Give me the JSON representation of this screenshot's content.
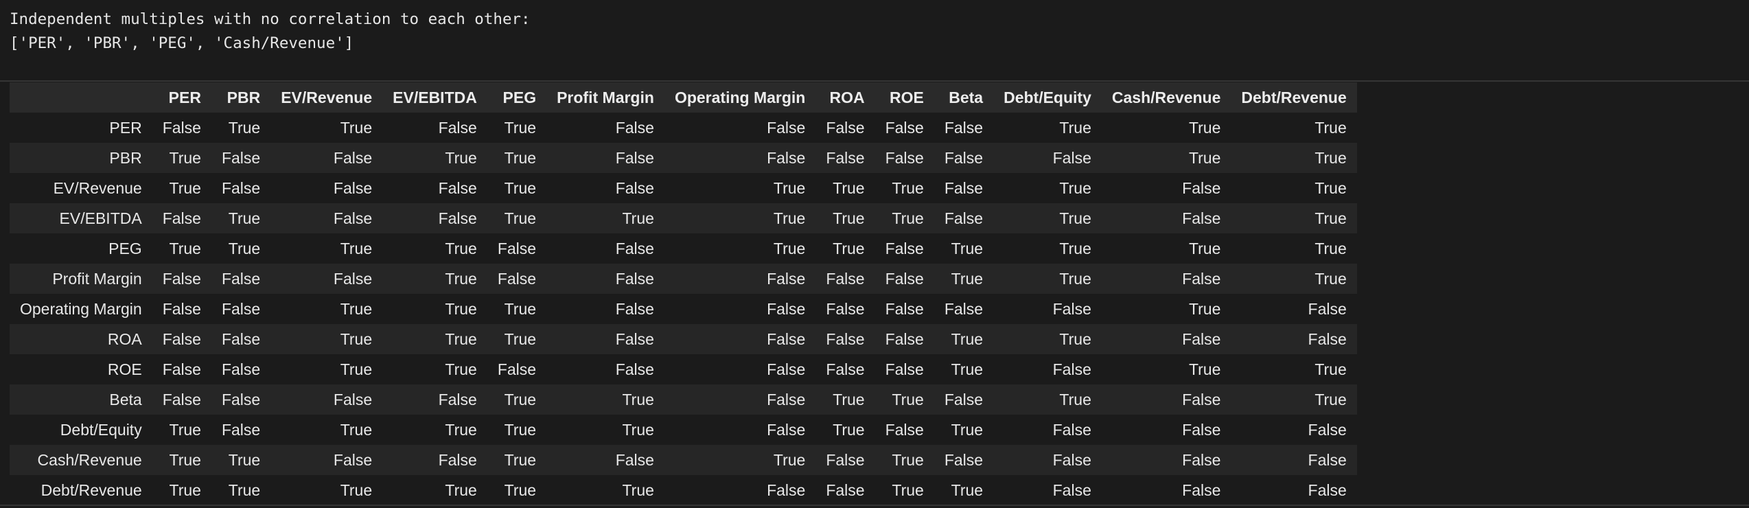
{
  "output": {
    "line1": "Independent multiples with no correlation to each other:",
    "line2": "['PER', 'PBR', 'PEG', 'Cash/Revenue']"
  },
  "table": {
    "columns": [
      "PER",
      "PBR",
      "EV/Revenue",
      "EV/EBITDA",
      "PEG",
      "Profit Margin",
      "Operating Margin",
      "ROA",
      "ROE",
      "Beta",
      "Debt/Equity",
      "Cash/Revenue",
      "Debt/Revenue"
    ],
    "rows": [
      {
        "label": "PER",
        "cells": [
          "False",
          "True",
          "True",
          "False",
          "True",
          "False",
          "False",
          "False",
          "False",
          "False",
          "True",
          "True",
          "True"
        ]
      },
      {
        "label": "PBR",
        "cells": [
          "True",
          "False",
          "False",
          "True",
          "True",
          "False",
          "False",
          "False",
          "False",
          "False",
          "False",
          "True",
          "True"
        ]
      },
      {
        "label": "EV/Revenue",
        "cells": [
          "True",
          "False",
          "False",
          "False",
          "True",
          "False",
          "True",
          "True",
          "True",
          "False",
          "True",
          "False",
          "True"
        ]
      },
      {
        "label": "EV/EBITDA",
        "cells": [
          "False",
          "True",
          "False",
          "False",
          "True",
          "True",
          "True",
          "True",
          "True",
          "False",
          "True",
          "False",
          "True"
        ]
      },
      {
        "label": "PEG",
        "cells": [
          "True",
          "True",
          "True",
          "True",
          "False",
          "False",
          "True",
          "True",
          "False",
          "True",
          "True",
          "True",
          "True"
        ]
      },
      {
        "label": "Profit Margin",
        "cells": [
          "False",
          "False",
          "False",
          "True",
          "False",
          "False",
          "False",
          "False",
          "False",
          "True",
          "True",
          "False",
          "True"
        ]
      },
      {
        "label": "Operating Margin",
        "cells": [
          "False",
          "False",
          "True",
          "True",
          "True",
          "False",
          "False",
          "False",
          "False",
          "False",
          "False",
          "True",
          "False"
        ]
      },
      {
        "label": "ROA",
        "cells": [
          "False",
          "False",
          "True",
          "True",
          "True",
          "False",
          "False",
          "False",
          "False",
          "True",
          "True",
          "False",
          "False"
        ]
      },
      {
        "label": "ROE",
        "cells": [
          "False",
          "False",
          "True",
          "True",
          "False",
          "False",
          "False",
          "False",
          "False",
          "True",
          "False",
          "True",
          "True"
        ]
      },
      {
        "label": "Beta",
        "cells": [
          "False",
          "False",
          "False",
          "False",
          "True",
          "True",
          "False",
          "True",
          "True",
          "False",
          "True",
          "False",
          "True"
        ]
      },
      {
        "label": "Debt/Equity",
        "cells": [
          "True",
          "False",
          "True",
          "True",
          "True",
          "True",
          "False",
          "True",
          "False",
          "True",
          "False",
          "False",
          "False"
        ]
      },
      {
        "label": "Cash/Revenue",
        "cells": [
          "True",
          "True",
          "False",
          "False",
          "True",
          "False",
          "True",
          "False",
          "True",
          "False",
          "False",
          "False",
          "False"
        ]
      },
      {
        "label": "Debt/Revenue",
        "cells": [
          "True",
          "True",
          "True",
          "True",
          "True",
          "True",
          "False",
          "False",
          "True",
          "True",
          "False",
          "False",
          "False"
        ]
      }
    ]
  }
}
